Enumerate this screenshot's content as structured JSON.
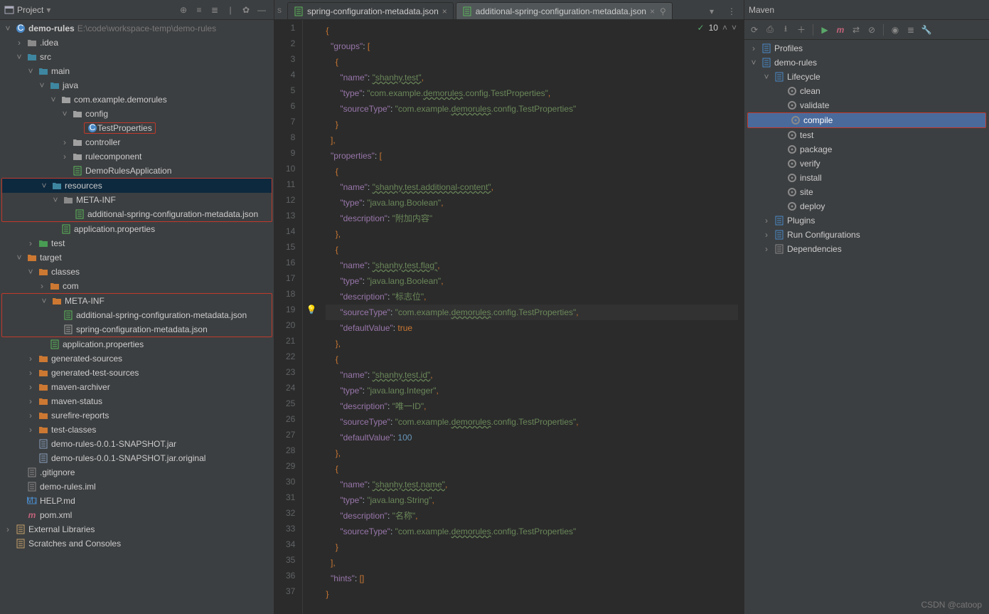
{
  "project": {
    "title": "Project",
    "toolbar_icons": [
      "target-icon",
      "collapse-icon",
      "expand-icon",
      "divider",
      "settings-icon",
      "hide-icon"
    ],
    "root_module": "demo-rules",
    "root_path": "E:\\code\\workspace-temp\\demo-rules",
    "tree": [
      {
        "d": 0,
        "e": "v",
        "i": "module",
        "t": "demo-rules",
        "sub": "E:\\code\\workspace-temp\\demo-rules",
        "bold": true
      },
      {
        "d": 1,
        "e": ">",
        "i": "folder",
        "t": ".idea"
      },
      {
        "d": 1,
        "e": "v",
        "i": "folder-blue",
        "t": "src"
      },
      {
        "d": 2,
        "e": "v",
        "i": "folder-blue",
        "t": "main"
      },
      {
        "d": 3,
        "e": "v",
        "i": "folder-blue",
        "t": "java"
      },
      {
        "d": 4,
        "e": "v",
        "i": "package",
        "t": "com.example.demorules"
      },
      {
        "d": 5,
        "e": "v",
        "i": "package",
        "t": "config"
      },
      {
        "d": 6,
        "e": "",
        "i": "class",
        "t": "TestProperties",
        "red": true
      },
      {
        "d": 5,
        "e": ">",
        "i": "package",
        "t": "controller"
      },
      {
        "d": 5,
        "e": ">",
        "i": "package",
        "t": "rulecomponent"
      },
      {
        "d": 5,
        "e": "",
        "i": "springboot",
        "t": "DemoRulesApplication"
      },
      {
        "d": 3,
        "e": "v",
        "i": "folder-res",
        "t": "resources",
        "sel": true,
        "redwrap": "start"
      },
      {
        "d": 4,
        "e": "v",
        "i": "folder",
        "t": "META-INF"
      },
      {
        "d": 5,
        "e": "",
        "i": "json-spring",
        "t": "additional-spring-configuration-metadata.json",
        "redwrap": "end"
      },
      {
        "d": 4,
        "e": "",
        "i": "springprop",
        "t": "application.properties"
      },
      {
        "d": 2,
        "e": ">",
        "i": "folder-green",
        "t": "test"
      },
      {
        "d": 1,
        "e": "v",
        "i": "folder-orange",
        "t": "target"
      },
      {
        "d": 2,
        "e": "v",
        "i": "folder-orange",
        "t": "classes"
      },
      {
        "d": 3,
        "e": ">",
        "i": "folder-orange",
        "t": "com"
      },
      {
        "d": 3,
        "e": "v",
        "i": "folder-orange",
        "t": "META-INF",
        "redwrap": "start"
      },
      {
        "d": 4,
        "e": "",
        "i": "json-spring",
        "t": "additional-spring-configuration-metadata.json"
      },
      {
        "d": 4,
        "e": "",
        "i": "json",
        "t": "spring-configuration-metadata.json",
        "redwrap": "end"
      },
      {
        "d": 3,
        "e": "",
        "i": "springprop",
        "t": "application.properties"
      },
      {
        "d": 2,
        "e": ">",
        "i": "folder-orange",
        "t": "generated-sources"
      },
      {
        "d": 2,
        "e": ">",
        "i": "folder-orange",
        "t": "generated-test-sources"
      },
      {
        "d": 2,
        "e": ">",
        "i": "folder-orange",
        "t": "maven-archiver"
      },
      {
        "d": 2,
        "e": ">",
        "i": "folder-orange",
        "t": "maven-status"
      },
      {
        "d": 2,
        "e": ">",
        "i": "folder-orange",
        "t": "surefire-reports"
      },
      {
        "d": 2,
        "e": ">",
        "i": "folder-orange",
        "t": "test-classes"
      },
      {
        "d": 2,
        "e": "",
        "i": "jar",
        "t": "demo-rules-0.0.1-SNAPSHOT.jar"
      },
      {
        "d": 2,
        "e": "",
        "i": "jar",
        "t": "demo-rules-0.0.1-SNAPSHOT.jar.original"
      },
      {
        "d": 1,
        "e": "",
        "i": "file",
        "t": ".gitignore"
      },
      {
        "d": 1,
        "e": "",
        "i": "file",
        "t": "demo-rules.iml"
      },
      {
        "d": 1,
        "e": "",
        "i": "markdown",
        "t": "HELP.md"
      },
      {
        "d": 1,
        "e": "",
        "i": "maven",
        "t": "pom.xml"
      },
      {
        "d": 0,
        "e": ">",
        "i": "lib",
        "t": "External Libraries"
      },
      {
        "d": 0,
        "e": "",
        "i": "scratch",
        "t": "Scratches and Consoles"
      }
    ]
  },
  "editor": {
    "prefix": "s",
    "tabs": [
      {
        "icon": "json-spring",
        "label": "spring-configuration-metadata.json",
        "active": false
      },
      {
        "icon": "json-spring",
        "label": "additional-spring-configuration-metadata.json",
        "active": true,
        "pinned": true
      }
    ],
    "trail_dropdown": "▾",
    "trail_more": "⋮",
    "inspection": {
      "check": "✓",
      "count": "10",
      "up": "˄",
      "down": "˅"
    },
    "bulb_line": 19,
    "lines": [
      [
        {
          "p": "{"
        }
      ],
      [
        {
          "sp": 2
        },
        {
          "k": "\"groups\""
        },
        {
          "c": ": "
        },
        {
          "p": "["
        }
      ],
      [
        {
          "sp": 4
        },
        {
          "p": "{"
        }
      ],
      [
        {
          "sp": 6
        },
        {
          "k": "\"name\""
        },
        {
          "c": ": "
        },
        {
          "su": "\"shanhy.test\""
        },
        {
          "p": ","
        }
      ],
      [
        {
          "sp": 6
        },
        {
          "k": "\"type\""
        },
        {
          "c": ": "
        },
        {
          "s": "\"com.example."
        },
        {
          "su": "demorules"
        },
        {
          "s": ".config.TestProperties\""
        },
        {
          "p": ","
        }
      ],
      [
        {
          "sp": 6
        },
        {
          "k": "\"sourceType\""
        },
        {
          "c": ": "
        },
        {
          "s": "\"com.example."
        },
        {
          "su": "demorules"
        },
        {
          "s": ".config.TestProperties\""
        }
      ],
      [
        {
          "sp": 4
        },
        {
          "p": "}"
        }
      ],
      [
        {
          "sp": 2
        },
        {
          "p": "],"
        }
      ],
      [
        {
          "sp": 2
        },
        {
          "k": "\"properties\""
        },
        {
          "c": ": "
        },
        {
          "p": "["
        }
      ],
      [
        {
          "sp": 4
        },
        {
          "p": "{"
        }
      ],
      [
        {
          "sp": 6
        },
        {
          "k": "\"name\""
        },
        {
          "c": ": "
        },
        {
          "su": "\"shanhy.test.additional-content\""
        },
        {
          "p": ","
        }
      ],
      [
        {
          "sp": 6
        },
        {
          "k": "\"type\""
        },
        {
          "c": ": "
        },
        {
          "s": "\"java.lang.Boolean\""
        },
        {
          "p": ","
        }
      ],
      [
        {
          "sp": 6
        },
        {
          "k": "\"description\""
        },
        {
          "c": ": "
        },
        {
          "s": "\"附加内容\""
        }
      ],
      [
        {
          "sp": 4
        },
        {
          "p": "},"
        }
      ],
      [
        {
          "sp": 4
        },
        {
          "p": "{"
        }
      ],
      [
        {
          "sp": 6
        },
        {
          "k": "\"name\""
        },
        {
          "c": ": "
        },
        {
          "su": "\"shanhy.test.flag\""
        },
        {
          "p": ","
        }
      ],
      [
        {
          "sp": 6
        },
        {
          "k": "\"type\""
        },
        {
          "c": ": "
        },
        {
          "s": "\"java.lang.Boolean\""
        },
        {
          "p": ","
        }
      ],
      [
        {
          "sp": 6
        },
        {
          "k": "\"description\""
        },
        {
          "c": ": "
        },
        {
          "s": "\"标志位\""
        },
        {
          "p": ","
        }
      ],
      [
        {
          "sp": 6,
          "cur": true
        },
        {
          "k": "\"sourceType\""
        },
        {
          "c": ": "
        },
        {
          "s": "\"com.example."
        },
        {
          "su": "demorules"
        },
        {
          "s": ".config.TestProperties\""
        },
        {
          "p": ","
        }
      ],
      [
        {
          "sp": 6
        },
        {
          "k": "\"defaultValue\""
        },
        {
          "c": ": "
        },
        {
          "b": "true"
        }
      ],
      [
        {
          "sp": 4
        },
        {
          "p": "},"
        }
      ],
      [
        {
          "sp": 4
        },
        {
          "p": "{"
        }
      ],
      [
        {
          "sp": 6
        },
        {
          "k": "\"name\""
        },
        {
          "c": ": "
        },
        {
          "su": "\"shanhy.test.id\""
        },
        {
          "p": ","
        }
      ],
      [
        {
          "sp": 6
        },
        {
          "k": "\"type\""
        },
        {
          "c": ": "
        },
        {
          "s": "\"java.lang.Integer\""
        },
        {
          "p": ","
        }
      ],
      [
        {
          "sp": 6
        },
        {
          "k": "\"description\""
        },
        {
          "c": ": "
        },
        {
          "s": "\"唯一ID\""
        },
        {
          "p": ","
        }
      ],
      [
        {
          "sp": 6
        },
        {
          "k": "\"sourceType\""
        },
        {
          "c": ": "
        },
        {
          "s": "\"com.example."
        },
        {
          "su": "demorules"
        },
        {
          "s": ".config.TestProperties\""
        },
        {
          "p": ","
        }
      ],
      [
        {
          "sp": 6
        },
        {
          "k": "\"defaultValue\""
        },
        {
          "c": ": "
        },
        {
          "n": "100"
        }
      ],
      [
        {
          "sp": 4
        },
        {
          "p": "},"
        }
      ],
      [
        {
          "sp": 4
        },
        {
          "p": "{"
        }
      ],
      [
        {
          "sp": 6
        },
        {
          "k": "\"name\""
        },
        {
          "c": ": "
        },
        {
          "su": "\"shanhy.test.name\""
        },
        {
          "p": ","
        }
      ],
      [
        {
          "sp": 6
        },
        {
          "k": "\"type\""
        },
        {
          "c": ": "
        },
        {
          "s": "\"java.lang.String\""
        },
        {
          "p": ","
        }
      ],
      [
        {
          "sp": 6
        },
        {
          "k": "\"description\""
        },
        {
          "c": ": "
        },
        {
          "s": "\"名称\""
        },
        {
          "p": ","
        }
      ],
      [
        {
          "sp": 6
        },
        {
          "k": "\"sourceType\""
        },
        {
          "c": ": "
        },
        {
          "s": "\"com.example."
        },
        {
          "su": "demorules"
        },
        {
          "s": ".config.TestProperties\""
        }
      ],
      [
        {
          "sp": 4
        },
        {
          "p": "}"
        }
      ],
      [
        {
          "sp": 2
        },
        {
          "p": "],"
        }
      ],
      [
        {
          "sp": 2
        },
        {
          "k": "\"hints\""
        },
        {
          "c": ": "
        },
        {
          "p": "[]"
        }
      ],
      [
        {
          "p": "}"
        }
      ]
    ]
  },
  "maven": {
    "title": "Maven",
    "toolbar": [
      "reload-icon",
      "generate-icon",
      "download-icon",
      "plus-icon",
      "sep",
      "play-icon",
      "m-icon",
      "toggle-icon",
      "skip-icon",
      "sep",
      "offline-icon",
      "collapse-icon",
      "settings-icon"
    ],
    "tree": [
      {
        "d": 0,
        "e": ">",
        "i": "profiles",
        "t": "Profiles"
      },
      {
        "d": 0,
        "e": "v",
        "i": "mvnproj",
        "t": "demo-rules"
      },
      {
        "d": 1,
        "e": "v",
        "i": "lifecycle",
        "t": "Lifecycle"
      },
      {
        "d": 2,
        "e": "",
        "i": "gear",
        "t": "clean"
      },
      {
        "d": 2,
        "e": "",
        "i": "gear",
        "t": "validate"
      },
      {
        "d": 2,
        "e": "",
        "i": "gear",
        "t": "compile",
        "sel": true,
        "red": true
      },
      {
        "d": 2,
        "e": "",
        "i": "gear",
        "t": "test"
      },
      {
        "d": 2,
        "e": "",
        "i": "gear",
        "t": "package"
      },
      {
        "d": 2,
        "e": "",
        "i": "gear",
        "t": "verify"
      },
      {
        "d": 2,
        "e": "",
        "i": "gear",
        "t": "install"
      },
      {
        "d": 2,
        "e": "",
        "i": "gear",
        "t": "site"
      },
      {
        "d": 2,
        "e": "",
        "i": "gear",
        "t": "deploy"
      },
      {
        "d": 1,
        "e": ">",
        "i": "plugins",
        "t": "Plugins"
      },
      {
        "d": 1,
        "e": ">",
        "i": "runcfg",
        "t": "Run Configurations"
      },
      {
        "d": 1,
        "e": ">",
        "i": "deps",
        "t": "Dependencies"
      }
    ]
  },
  "watermark": "CSDN @catoop"
}
